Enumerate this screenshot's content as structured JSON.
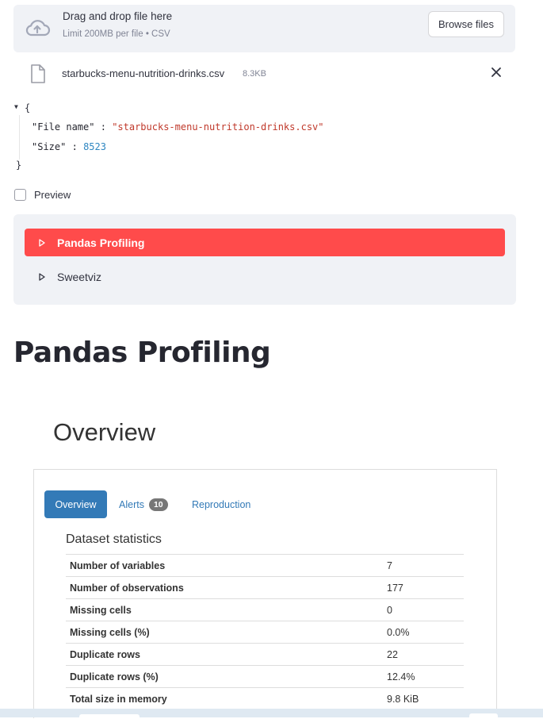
{
  "uploader": {
    "title": "Drag and drop file here",
    "limit": "Limit 200MB per file • CSV",
    "browse_label": "Browse files",
    "icon": "cloud-upload-icon"
  },
  "file": {
    "name": "starbucks-menu-nutrition-drinks.csv",
    "size": "8.3KB"
  },
  "json_view": {
    "open_brace": "{",
    "close_brace": "}",
    "entries": [
      {
        "key": "\"File name\"",
        "value": "\"starbucks-menu-nutrition-drinks.csv\""
      },
      {
        "key": "\"Size\"",
        "value": "8523"
      }
    ],
    "separator": ":"
  },
  "preview": {
    "label": "Preview",
    "checked": false
  },
  "menu": {
    "items": [
      {
        "label": "Pandas Profiling",
        "active": true
      },
      {
        "label": "Sweetviz",
        "active": false
      }
    ],
    "active_color": "#ff4b4b"
  },
  "page_title": "Pandas Profiling",
  "report": {
    "section_title": "Overview",
    "tabs": {
      "overview": "Overview",
      "alerts": "Alerts",
      "alerts_count": "10",
      "reproduction": "Reproduction"
    },
    "dataset_title": "Dataset statistics",
    "rows": [
      {
        "label": "Number of variables",
        "value": "7"
      },
      {
        "label": "Number of observations",
        "value": "177"
      },
      {
        "label": "Missing cells",
        "value": "0"
      },
      {
        "label": "Missing cells (%)",
        "value": "0.0%"
      },
      {
        "label": "Duplicate rows",
        "value": "22"
      },
      {
        "label": "Duplicate rows (%)",
        "value": "12.4%"
      },
      {
        "label": "Total size in memory",
        "value": "9.8 KiB"
      }
    ]
  },
  "colors": {
    "accent": "#ff4b4b",
    "tab_blue": "#337ab7",
    "panel_bg": "#f0f2f6"
  }
}
